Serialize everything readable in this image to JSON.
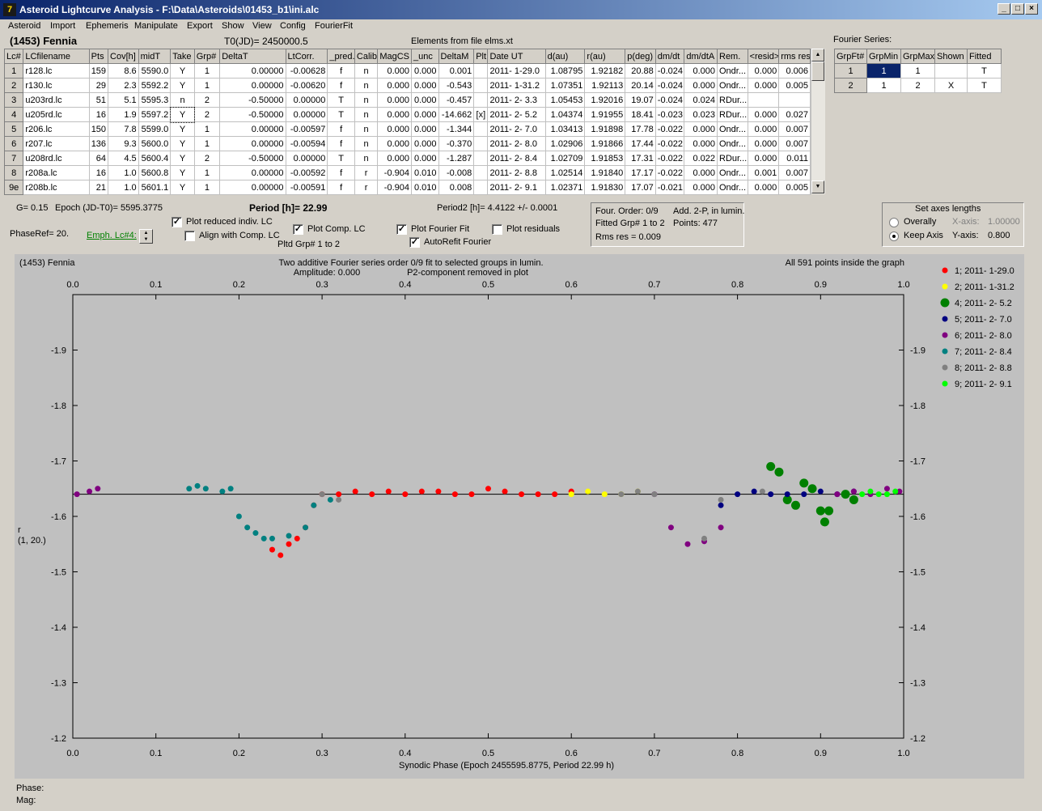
{
  "window": {
    "title": "Asteroid Lightcurve Analysis - F:\\Data\\Asteroids\\01453_b1\\ini.alc",
    "icon": "app-icon"
  },
  "menu": [
    "Asteroid",
    "Import",
    "Ephemeris",
    "Manipulate",
    "Export",
    "Show",
    "View",
    "Config",
    "FourierFit"
  ],
  "header": {
    "asteroid": "(1453) Fennia",
    "t0": "T0(JD)= 2450000.5",
    "elements": "Elements from file elms.xt",
    "fourier_title": "Fourier Series:"
  },
  "lc_table": {
    "columns": [
      "Lc#",
      "LCfilename",
      "Pts",
      "Cov[h]",
      "midT",
      "Take",
      "Grp#",
      "DeltaT",
      "LtCorr.",
      "_pred.",
      "Calib.",
      "MagCS",
      "_unc",
      "DeltaM",
      "Plt",
      "Date UT",
      "d(au)",
      "r(au)",
      "p(deg)",
      "dm/dt",
      "dm/dtA",
      "Rem.",
      "<resid>",
      "rms res"
    ],
    "rows": [
      [
        "1",
        "r128.lc",
        "159",
        "8.6",
        "5590.0",
        "Y",
        "1",
        "0.00000",
        "-0.00628",
        "f",
        "n",
        "0.000",
        "0.000",
        "0.001",
        "",
        "2011- 1-29.0",
        "1.08795",
        "1.92182",
        "20.88",
        "-0.024",
        "0.000",
        "Ondr...",
        "0.000",
        "0.006"
      ],
      [
        "2",
        "r130.lc",
        "29",
        "2.3",
        "5592.2",
        "Y",
        "1",
        "0.00000",
        "-0.00620",
        "f",
        "n",
        "0.000",
        "0.000",
        "-0.543",
        "",
        "2011- 1-31.2",
        "1.07351",
        "1.92113",
        "20.14",
        "-0.024",
        "0.000",
        "Ondr...",
        "0.000",
        "0.005"
      ],
      [
        "3",
        "u203rd.lc",
        "51",
        "5.1",
        "5595.3",
        "n",
        "2",
        "-0.50000",
        "0.00000",
        "T",
        "n",
        "0.000",
        "0.000",
        "-0.457",
        "",
        "2011- 2- 3.3",
        "1.05453",
        "1.92016",
        "19.07",
        "-0.024",
        "0.024",
        "RDur...",
        "",
        ""
      ],
      [
        "4",
        "u205rd.lc",
        "16",
        "1.9",
        "5597.2",
        "Y",
        "2",
        "-0.50000",
        "0.00000",
        "T",
        "n",
        "0.000",
        "0.000",
        "-14.662",
        "[x]",
        "2011- 2- 5.2",
        "1.04374",
        "1.91955",
        "18.41",
        "-0.023",
        "0.023",
        "RDur...",
        "0.000",
        "0.027"
      ],
      [
        "5",
        "r206.lc",
        "150",
        "7.8",
        "5599.0",
        "Y",
        "1",
        "0.00000",
        "-0.00597",
        "f",
        "n",
        "0.000",
        "0.000",
        "-1.344",
        "",
        "2011- 2- 7.0",
        "1.03413",
        "1.91898",
        "17.78",
        "-0.022",
        "0.000",
        "Ondr...",
        "0.000",
        "0.007"
      ],
      [
        "6",
        "r207.lc",
        "136",
        "9.3",
        "5600.0",
        "Y",
        "1",
        "0.00000",
        "-0.00594",
        "f",
        "n",
        "0.000",
        "0.000",
        "-0.370",
        "",
        "2011- 2- 8.0",
        "1.02906",
        "1.91866",
        "17.44",
        "-0.022",
        "0.000",
        "Ondr...",
        "0.000",
        "0.007"
      ],
      [
        "7",
        "u208rd.lc",
        "64",
        "4.5",
        "5600.4",
        "Y",
        "2",
        "-0.50000",
        "0.00000",
        "T",
        "n",
        "0.000",
        "0.000",
        "-1.287",
        "",
        "2011- 2- 8.4",
        "1.02709",
        "1.91853",
        "17.31",
        "-0.022",
        "0.022",
        "RDur...",
        "0.000",
        "0.011"
      ],
      [
        "8",
        "r208a.lc",
        "16",
        "1.0",
        "5600.8",
        "Y",
        "1",
        "0.00000",
        "-0.00592",
        "f",
        "r",
        "-0.904",
        "0.010",
        "-0.008",
        "",
        "2011- 2- 8.8",
        "1.02514",
        "1.91840",
        "17.17",
        "-0.022",
        "0.000",
        "Ondr...",
        "0.001",
        "0.007"
      ],
      [
        "9e",
        "r208b.lc",
        "21",
        "1.0",
        "5601.1",
        "Y",
        "1",
        "0.00000",
        "-0.00591",
        "f",
        "r",
        "-0.904",
        "0.010",
        "0.008",
        "",
        "2011- 2- 9.1",
        "1.02371",
        "1.91830",
        "17.07",
        "-0.021",
        "0.000",
        "Ondr...",
        "0.000",
        "0.005"
      ]
    ]
  },
  "fourier_table": {
    "columns": [
      "GrpFt#",
      "GrpMin",
      "GrpMax",
      "Shown",
      "Fitted"
    ],
    "rows": [
      [
        "1",
        "1",
        "1",
        "",
        "T"
      ],
      [
        "2",
        "1",
        "2",
        "X",
        "T"
      ]
    ]
  },
  "params": {
    "g": "G= 0.15",
    "epoch": "Epoch (JD-T0)= 5595.3775",
    "period": "Period [h]= 22.99",
    "period2": "Period2 [h]= 4.4122 +/- 0.0001",
    "phase_ref": "PhaseRef= 20.",
    "emph": "Emph. Lc#4:"
  },
  "checkboxes": {
    "plot_reduced": {
      "label": "Plot reduced indiv. LC",
      "checked": true
    },
    "align_comp": {
      "label": "Align with Comp. LC",
      "checked": false
    },
    "plot_comp": {
      "label": "Plot Comp. LC",
      "checked": true
    },
    "pltd_grp": "Pltd Grp#  1   to   2",
    "plot_fourier": {
      "label": "Plot Fourier Fit",
      "checked": true
    },
    "autorefit": {
      "label": "AutoRefit Fourier",
      "checked": true
    },
    "plot_residuals": {
      "label": "Plot residuals",
      "checked": false
    }
  },
  "fourier_info": {
    "order": "Four. Order:  0/9",
    "add": "Add. 2-P, in lumin.",
    "fitted": "Fitted Grp# 1 to 2",
    "points": "Points: 477",
    "rms": "Rms res      = 0.009"
  },
  "axes_panel": {
    "title": "Set axes lengths",
    "overally": "Overally",
    "keep_axis": "Keep Axis",
    "xaxis_label": "X-axis:",
    "xaxis_value": "1.00000",
    "yaxis_label": "Y-axis:",
    "yaxis_value": "0.800",
    "selected": "keep_axis"
  },
  "plot": {
    "name": "(1453) Fennia",
    "subtitle1": "Two additive Fourier series order 0/9 fit to selected groups in lumin.",
    "subtitle2": "Amplitude: 0.000",
    "subtitle3": "P2-component removed in plot",
    "points_note": "All 591 points inside the graph",
    "xlabel": "Synodic Phase (Epoch 2455595.8775, Period 22.99 h)",
    "ylabel1": "r",
    "ylabel2": "(1, 20.)",
    "fit_level": -1.64
  },
  "footer": {
    "phase": "Phase:",
    "mag": "Mag:"
  },
  "chart_data": {
    "type": "scatter",
    "xlim": [
      0.0,
      1.0
    ],
    "ylim": [
      -1.2,
      -2.0
    ],
    "x_ticks": [
      "0.0",
      "0.1",
      "0.2",
      "0.3",
      "0.4",
      "0.5",
      "0.6",
      "0.7",
      "0.8",
      "0.9",
      "1.0"
    ],
    "y_ticks": [
      "-1.9",
      "-1.8",
      "-1.7",
      "-1.6",
      "-1.5",
      "-1.4",
      "-1.3",
      "-1.2"
    ],
    "fit_line": -1.64,
    "series": [
      {
        "name": "1; 2011- 1-29.0",
        "color": "#ff0000",
        "size": "small",
        "points": [
          [
            0.24,
            -1.54
          ],
          [
            0.25,
            -1.53
          ],
          [
            0.26,
            -1.55
          ],
          [
            0.27,
            -1.56
          ],
          [
            0.28,
            -1.58
          ],
          [
            0.29,
            -1.62
          ],
          [
            0.3,
            -1.64
          ],
          [
            0.32,
            -1.64
          ],
          [
            0.34,
            -1.645
          ],
          [
            0.36,
            -1.64
          ],
          [
            0.38,
            -1.645
          ],
          [
            0.4,
            -1.64
          ],
          [
            0.42,
            -1.645
          ],
          [
            0.44,
            -1.645
          ],
          [
            0.46,
            -1.64
          ],
          [
            0.48,
            -1.64
          ],
          [
            0.5,
            -1.65
          ],
          [
            0.52,
            -1.645
          ],
          [
            0.54,
            -1.64
          ],
          [
            0.56,
            -1.64
          ],
          [
            0.58,
            -1.64
          ],
          [
            0.6,
            -1.645
          ]
        ]
      },
      {
        "name": "2; 2011- 1-31.2",
        "color": "#ffff00",
        "size": "small",
        "points": [
          [
            0.6,
            -1.64
          ],
          [
            0.62,
            -1.645
          ],
          [
            0.64,
            -1.64
          ],
          [
            0.66,
            -1.64
          ],
          [
            0.68,
            -1.645
          ]
        ]
      },
      {
        "name": "4; 2011- 2- 5.2",
        "color": "#008000",
        "size": "large",
        "points": [
          [
            0.84,
            -1.69
          ],
          [
            0.85,
            -1.68
          ],
          [
            0.86,
            -1.63
          ],
          [
            0.87,
            -1.62
          ],
          [
            0.88,
            -1.66
          ],
          [
            0.89,
            -1.65
          ],
          [
            0.9,
            -1.61
          ],
          [
            0.905,
            -1.59
          ],
          [
            0.91,
            -1.61
          ],
          [
            0.93,
            -1.64
          ],
          [
            0.94,
            -1.63
          ]
        ]
      },
      {
        "name": "5; 2011- 2- 7.0",
        "color": "#000080",
        "size": "small",
        "points": [
          [
            0.78,
            -1.62
          ],
          [
            0.8,
            -1.64
          ],
          [
            0.82,
            -1.645
          ],
          [
            0.84,
            -1.64
          ],
          [
            0.86,
            -1.64
          ],
          [
            0.88,
            -1.64
          ],
          [
            0.9,
            -1.645
          ],
          [
            0.92,
            -1.64
          ],
          [
            0.94,
            -1.645
          ]
        ]
      },
      {
        "name": "6; 2011- 2- 8.0",
        "color": "#800080",
        "size": "small",
        "points": [
          [
            0.005,
            -1.64
          ],
          [
            0.02,
            -1.645
          ],
          [
            0.03,
            -1.65
          ],
          [
            0.7,
            -1.64
          ],
          [
            0.72,
            -1.58
          ],
          [
            0.74,
            -1.55
          ],
          [
            0.76,
            -1.555
          ],
          [
            0.78,
            -1.58
          ],
          [
            0.92,
            -1.64
          ],
          [
            0.94,
            -1.645
          ],
          [
            0.96,
            -1.64
          ],
          [
            0.98,
            -1.65
          ],
          [
            0.995,
            -1.645
          ]
        ]
      },
      {
        "name": "7; 2011- 2- 8.4",
        "color": "#008080",
        "size": "small",
        "points": [
          [
            0.14,
            -1.65
          ],
          [
            0.15,
            -1.655
          ],
          [
            0.16,
            -1.65
          ],
          [
            0.18,
            -1.645
          ],
          [
            0.19,
            -1.65
          ],
          [
            0.2,
            -1.6
          ],
          [
            0.21,
            -1.58
          ],
          [
            0.22,
            -1.57
          ],
          [
            0.23,
            -1.56
          ],
          [
            0.24,
            -1.56
          ],
          [
            0.26,
            -1.565
          ],
          [
            0.28,
            -1.58
          ],
          [
            0.29,
            -1.62
          ],
          [
            0.31,
            -1.63
          ]
        ]
      },
      {
        "name": "8; 2011- 2- 8.8",
        "color": "#808080",
        "size": "small",
        "points": [
          [
            0.3,
            -1.64
          ],
          [
            0.32,
            -1.63
          ],
          [
            0.66,
            -1.64
          ],
          [
            0.68,
            -1.645
          ],
          [
            0.7,
            -1.64
          ],
          [
            0.76,
            -1.56
          ],
          [
            0.78,
            -1.63
          ],
          [
            0.83,
            -1.645
          ]
        ]
      },
      {
        "name": "9; 2011- 2- 9.1",
        "color": "#00ff00",
        "size": "small",
        "points": [
          [
            0.95,
            -1.64
          ],
          [
            0.96,
            -1.645
          ],
          [
            0.97,
            -1.64
          ],
          [
            0.98,
            -1.64
          ],
          [
            0.99,
            -1.645
          ]
        ]
      }
    ]
  }
}
